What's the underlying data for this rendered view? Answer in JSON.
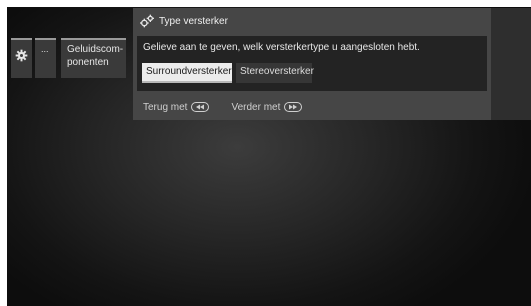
{
  "breadcrumb": {
    "settings_icon": "gear-icon",
    "more": "...",
    "current": "Geluidscom-ponenten",
    "current_line1": "Geluidscom-",
    "current_line2": "ponenten"
  },
  "dialog": {
    "icon": "gears-icon",
    "title": "Type versterker",
    "prompt": "Gelieve aan te geven, welk versterkertype u aangesloten hebt.",
    "options": [
      {
        "label": "Surroundversterker",
        "selected": true
      },
      {
        "label": "Stereoversterker",
        "selected": false
      }
    ],
    "footer": {
      "back_label": "Terug met",
      "back_icon": "rewind-button-icon",
      "next_label": "Verder met",
      "next_icon": "fast-forward-button-icon"
    }
  }
}
